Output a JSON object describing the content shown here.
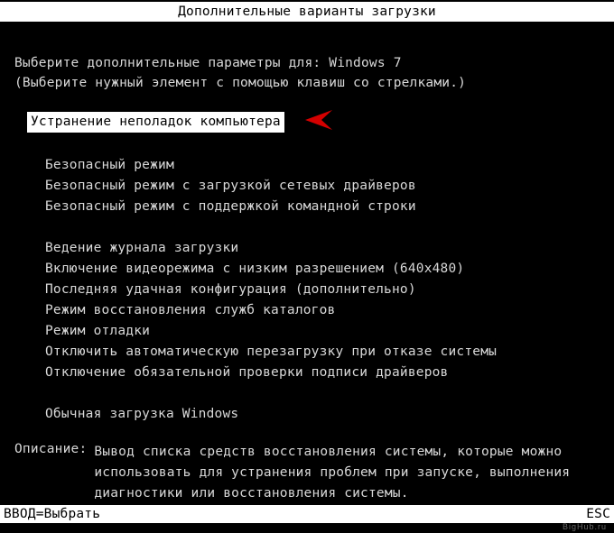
{
  "title": "Дополнительные варианты загрузки",
  "instruction_line1_prefix": "Выберите дополнительные параметры для: ",
  "os_name": "Windows 7",
  "instruction_line2": "(Выберите нужный элемент с помощью клавиш со стрелками.)",
  "menu": {
    "selected_index": 0,
    "items": [
      "Устранение неполадок компьютера",
      "Безопасный режим",
      "Безопасный режим с загрузкой сетевых драйверов",
      "Безопасный режим с поддержкой командной строки",
      "Ведение журнала загрузки",
      "Включение видеорежима с низким разрешением (640x480)",
      "Последняя удачная конфигурация (дополнительно)",
      "Режим восстановления служб каталогов",
      "Режим отладки",
      "Отключить автоматическую перезагрузку при отказе системы",
      "Отключение обязательной проверки подписи драйверов",
      "Обычная загрузка Windows"
    ]
  },
  "description_label": "Описание:",
  "description_text": "Вывод списка средств восстановления системы, которые можно использовать для устранения проблем при запуске, выполнения диагностики или восстановления системы.",
  "footer_left": "ВВОД=Выбрать",
  "footer_right": "ESC",
  "watermark": "BigHub.ru",
  "colors": {
    "bg": "#000000",
    "fg": "#d8d8d8",
    "hilite_bg": "#ffffff",
    "hilite_fg": "#000000",
    "arrow": "#d40000"
  }
}
